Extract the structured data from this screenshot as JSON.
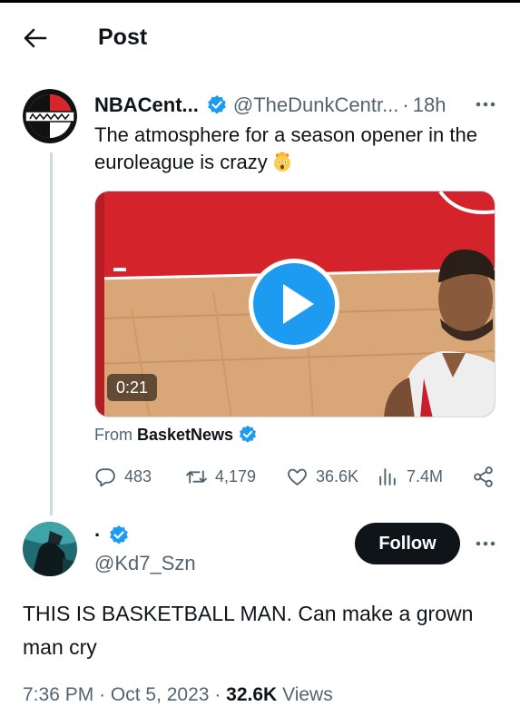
{
  "header": {
    "title": "Post",
    "back_icon": "arrow-left-icon"
  },
  "tweet": {
    "author_name": "NBACent...",
    "author_handle": "@TheDunkCentr...",
    "separator": "·",
    "time": "18h",
    "text": "The atmosphere for a season opener in the euroleague is crazy",
    "emoji": "exploding-head-emoji",
    "media": {
      "type": "video",
      "duration": "0:21"
    },
    "from_label": "From",
    "from_source": "BasketNews",
    "stats": {
      "replies": "483",
      "retweets": "4,179",
      "likes": "36.6K",
      "views": "7.4M"
    }
  },
  "reply": {
    "author_name": "·",
    "author_handle": "@Kd7_Szn",
    "follow_label": "Follow",
    "text": "THIS IS BASKETBALL MAN. Can make a grown man cry",
    "time": "7:36 PM",
    "sep1": "·",
    "date": "Oct 5, 2023",
    "sep2": "·",
    "views_count": "32.6K",
    "views_label": "Views"
  },
  "colors": {
    "accent": "#1d9bf0",
    "text": "#0f1419",
    "secondary": "#536471",
    "court_red": "#d6262c"
  }
}
